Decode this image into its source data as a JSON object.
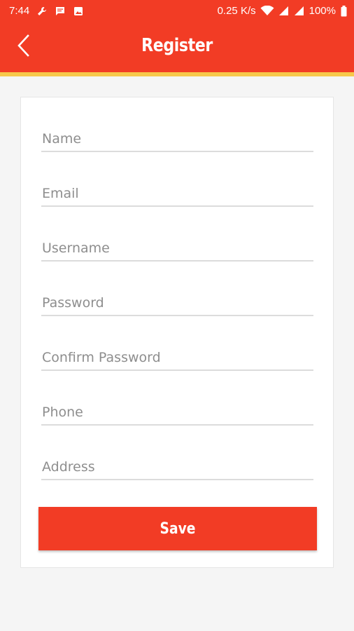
{
  "status_bar": {
    "time": "7:44",
    "network_speed": "0.25 K/s",
    "battery": "100%",
    "left_icons": [
      "wrench-icon",
      "message-icon",
      "image-icon"
    ],
    "right_icons": [
      "wifi-icon",
      "signal-icon",
      "signal-icon",
      "battery-icon"
    ]
  },
  "app_bar": {
    "title": "Register",
    "back_icon": "chevron-left-icon"
  },
  "form": {
    "fields": [
      {
        "name": "name",
        "placeholder": "Name",
        "value": ""
      },
      {
        "name": "email",
        "placeholder": "Email",
        "value": ""
      },
      {
        "name": "username",
        "placeholder": "Username",
        "value": ""
      },
      {
        "name": "password",
        "placeholder": "Password",
        "value": ""
      },
      {
        "name": "confirm_password",
        "placeholder": "Confirm Password",
        "value": ""
      },
      {
        "name": "phone",
        "placeholder": "Phone",
        "value": ""
      },
      {
        "name": "address",
        "placeholder": "Address",
        "value": ""
      }
    ],
    "save_label": "Save"
  },
  "colors": {
    "primary": "#f23c25",
    "accent_strip": "#f7c84b",
    "background": "#f5f5f5",
    "card": "#ffffff",
    "placeholder": "#8e8e8e",
    "underline": "#dcdcdc"
  }
}
